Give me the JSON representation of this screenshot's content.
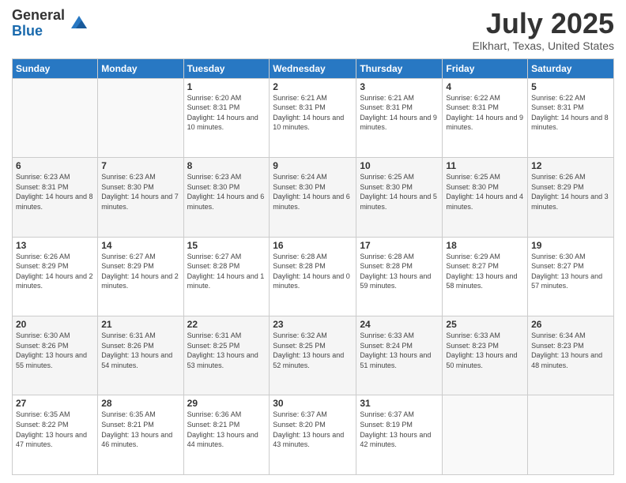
{
  "logo": {
    "general": "General",
    "blue": "Blue"
  },
  "title": "July 2025",
  "subtitle": "Elkhart, Texas, United States",
  "weekdays": [
    "Sunday",
    "Monday",
    "Tuesday",
    "Wednesday",
    "Thursday",
    "Friday",
    "Saturday"
  ],
  "weeks": [
    [
      {
        "day": "",
        "info": ""
      },
      {
        "day": "",
        "info": ""
      },
      {
        "day": "1",
        "info": "Sunrise: 6:20 AM\nSunset: 8:31 PM\nDaylight: 14 hours and 10 minutes."
      },
      {
        "day": "2",
        "info": "Sunrise: 6:21 AM\nSunset: 8:31 PM\nDaylight: 14 hours and 10 minutes."
      },
      {
        "day": "3",
        "info": "Sunrise: 6:21 AM\nSunset: 8:31 PM\nDaylight: 14 hours and 9 minutes."
      },
      {
        "day": "4",
        "info": "Sunrise: 6:22 AM\nSunset: 8:31 PM\nDaylight: 14 hours and 9 minutes."
      },
      {
        "day": "5",
        "info": "Sunrise: 6:22 AM\nSunset: 8:31 PM\nDaylight: 14 hours and 8 minutes."
      }
    ],
    [
      {
        "day": "6",
        "info": "Sunrise: 6:23 AM\nSunset: 8:31 PM\nDaylight: 14 hours and 8 minutes."
      },
      {
        "day": "7",
        "info": "Sunrise: 6:23 AM\nSunset: 8:30 PM\nDaylight: 14 hours and 7 minutes."
      },
      {
        "day": "8",
        "info": "Sunrise: 6:23 AM\nSunset: 8:30 PM\nDaylight: 14 hours and 6 minutes."
      },
      {
        "day": "9",
        "info": "Sunrise: 6:24 AM\nSunset: 8:30 PM\nDaylight: 14 hours and 6 minutes."
      },
      {
        "day": "10",
        "info": "Sunrise: 6:25 AM\nSunset: 8:30 PM\nDaylight: 14 hours and 5 minutes."
      },
      {
        "day": "11",
        "info": "Sunrise: 6:25 AM\nSunset: 8:30 PM\nDaylight: 14 hours and 4 minutes."
      },
      {
        "day": "12",
        "info": "Sunrise: 6:26 AM\nSunset: 8:29 PM\nDaylight: 14 hours and 3 minutes."
      }
    ],
    [
      {
        "day": "13",
        "info": "Sunrise: 6:26 AM\nSunset: 8:29 PM\nDaylight: 14 hours and 2 minutes."
      },
      {
        "day": "14",
        "info": "Sunrise: 6:27 AM\nSunset: 8:29 PM\nDaylight: 14 hours and 2 minutes."
      },
      {
        "day": "15",
        "info": "Sunrise: 6:27 AM\nSunset: 8:28 PM\nDaylight: 14 hours and 1 minute."
      },
      {
        "day": "16",
        "info": "Sunrise: 6:28 AM\nSunset: 8:28 PM\nDaylight: 14 hours and 0 minutes."
      },
      {
        "day": "17",
        "info": "Sunrise: 6:28 AM\nSunset: 8:28 PM\nDaylight: 13 hours and 59 minutes."
      },
      {
        "day": "18",
        "info": "Sunrise: 6:29 AM\nSunset: 8:27 PM\nDaylight: 13 hours and 58 minutes."
      },
      {
        "day": "19",
        "info": "Sunrise: 6:30 AM\nSunset: 8:27 PM\nDaylight: 13 hours and 57 minutes."
      }
    ],
    [
      {
        "day": "20",
        "info": "Sunrise: 6:30 AM\nSunset: 8:26 PM\nDaylight: 13 hours and 55 minutes."
      },
      {
        "day": "21",
        "info": "Sunrise: 6:31 AM\nSunset: 8:26 PM\nDaylight: 13 hours and 54 minutes."
      },
      {
        "day": "22",
        "info": "Sunrise: 6:31 AM\nSunset: 8:25 PM\nDaylight: 13 hours and 53 minutes."
      },
      {
        "day": "23",
        "info": "Sunrise: 6:32 AM\nSunset: 8:25 PM\nDaylight: 13 hours and 52 minutes."
      },
      {
        "day": "24",
        "info": "Sunrise: 6:33 AM\nSunset: 8:24 PM\nDaylight: 13 hours and 51 minutes."
      },
      {
        "day": "25",
        "info": "Sunrise: 6:33 AM\nSunset: 8:23 PM\nDaylight: 13 hours and 50 minutes."
      },
      {
        "day": "26",
        "info": "Sunrise: 6:34 AM\nSunset: 8:23 PM\nDaylight: 13 hours and 48 minutes."
      }
    ],
    [
      {
        "day": "27",
        "info": "Sunrise: 6:35 AM\nSunset: 8:22 PM\nDaylight: 13 hours and 47 minutes."
      },
      {
        "day": "28",
        "info": "Sunrise: 6:35 AM\nSunset: 8:21 PM\nDaylight: 13 hours and 46 minutes."
      },
      {
        "day": "29",
        "info": "Sunrise: 6:36 AM\nSunset: 8:21 PM\nDaylight: 13 hours and 44 minutes."
      },
      {
        "day": "30",
        "info": "Sunrise: 6:37 AM\nSunset: 8:20 PM\nDaylight: 13 hours and 43 minutes."
      },
      {
        "day": "31",
        "info": "Sunrise: 6:37 AM\nSunset: 8:19 PM\nDaylight: 13 hours and 42 minutes."
      },
      {
        "day": "",
        "info": ""
      },
      {
        "day": "",
        "info": ""
      }
    ]
  ]
}
